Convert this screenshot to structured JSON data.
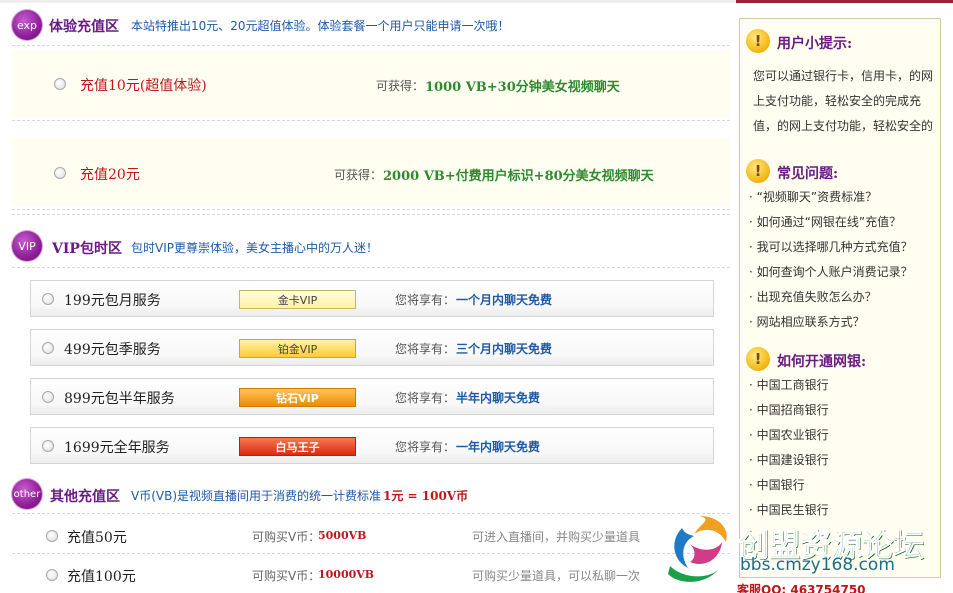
{
  "exp": {
    "badge": "exp",
    "title": "体验充值区",
    "desc": "本站特推出10元、20元超值体验。体验套餐一个用户只能申请一次哦！",
    "items": [
      {
        "label": "充值10元(超值体验)",
        "get_label": "可获得：",
        "get_value": "1000  VB+30分钟美女视频聊天"
      },
      {
        "label": "充值20元",
        "get_label": "可获得：",
        "get_value": "2000  VB+付费用户标识+80分美女视频聊天"
      }
    ]
  },
  "vip": {
    "badge": "VIP",
    "title": "VIP包时区",
    "desc": "包时VIP更尊崇体验，美女主播心中的万人迷！",
    "enjoy_label": "您将享有：",
    "items": [
      {
        "name": "199元包月服务",
        "badge": "金卡VIP",
        "enjoy": "一个月内聊天免费"
      },
      {
        "name": "499元包季服务",
        "badge": "铂金VIP",
        "enjoy": "三个月内聊天免费"
      },
      {
        "name": "899元包半年服务",
        "badge": "钻石VIP",
        "enjoy": "半年内聊天免费"
      },
      {
        "name": "1699元全年服务",
        "badge": "白马王子",
        "enjoy": "一年内聊天免费"
      }
    ]
  },
  "other": {
    "badge": "other",
    "title": "其他充值区",
    "desc": "V币(VB)是视频直播间用于消费的统一计费标准",
    "rate": "1元 = 100V币",
    "buy_label": "可购买V币：",
    "items": [
      {
        "name": "充值50元",
        "vb": "5000VB",
        "note": "可进入直播间，并购买少量道具"
      },
      {
        "name": "充值100元",
        "vb": "10000VB",
        "note": "可购买少量道具，可以私聊一次"
      }
    ]
  },
  "sidebar": {
    "tips": {
      "title": "用户小提示:",
      "text": "您可以通过银行卡，信用卡，的网上支付功能，轻松安全的完成充值，的网上支付功能，轻松安全的"
    },
    "faq": {
      "title": "常见问题:",
      "items": [
        "“视频聊天”资费标准？",
        "如何通过“网银在线”充值？",
        "我可以选择哪几种方式充值？",
        "如何查询个人账户消费记录？",
        "出现充值失败怎么办？",
        "网站相应联系方式？"
      ]
    },
    "bank": {
      "title": "如何开通网银:",
      "items": [
        "中国工商银行",
        "中国招商银行",
        "中国农业银行",
        "中国建设银行",
        "中国银行",
        "中国民生银行"
      ]
    }
  },
  "watermark": {
    "name": "创盟资源论坛",
    "url": "bbs.cmzy168.com",
    "qq": "客服QQ:  463754750"
  },
  "colors": {
    "accent_purple": "#6a1b84",
    "price_red": "#c0151b",
    "value_green": "#2e8a2e",
    "link_blue": "#1f5aa8",
    "gold_card": "#fff5a8",
    "platinum_card": "#ffd54a",
    "diamond_card": "#f7a11a",
    "prince_card": "#e8431e"
  }
}
